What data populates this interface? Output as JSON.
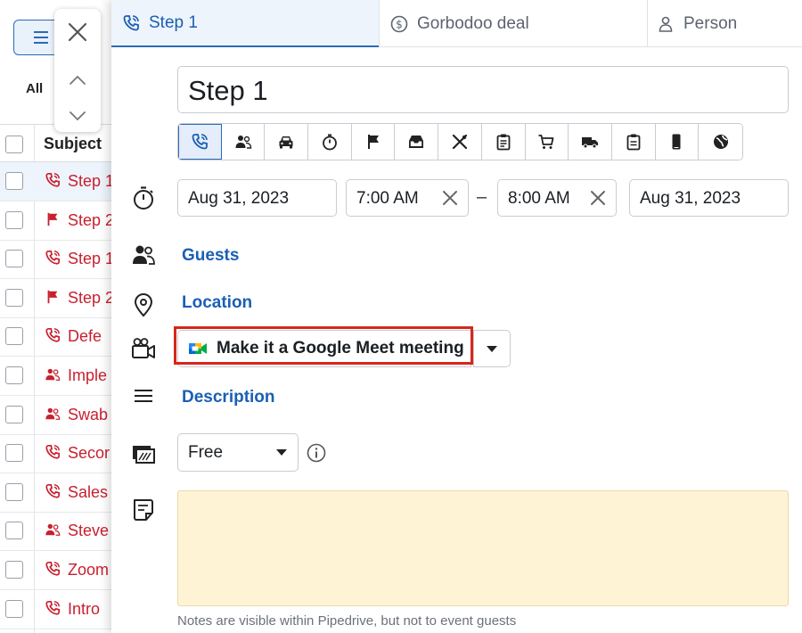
{
  "background_list": {
    "filter_label": "All",
    "subject_header": "Subject",
    "rows": [
      {
        "icon": "phone-icon",
        "text": "Step 1",
        "selected": true
      },
      {
        "icon": "flag-icon",
        "text": "Step 2"
      },
      {
        "icon": "phone-icon",
        "text": "Step 1"
      },
      {
        "icon": "flag-icon",
        "text": "Step 2"
      },
      {
        "icon": "phone-icon",
        "text": "Defe"
      },
      {
        "icon": "people-icon",
        "text": "Imple"
      },
      {
        "icon": "people-icon",
        "text": "Swab"
      },
      {
        "icon": "phone-icon",
        "text": "Secor"
      },
      {
        "icon": "phone-icon",
        "text": "Sales"
      },
      {
        "icon": "people-icon",
        "text": "Steve"
      },
      {
        "icon": "phone-icon",
        "text": "Zoom"
      },
      {
        "icon": "phone-icon",
        "text": "Intro"
      }
    ]
  },
  "tabs": [
    {
      "label": "Step 1",
      "icon": "phone-icon",
      "active": true
    },
    {
      "label": "Gorbodoo deal",
      "icon": "dollar-circle-icon"
    },
    {
      "label": "Person",
      "icon": "person-icon"
    }
  ],
  "activity": {
    "title": "Step 1",
    "types": [
      "phone",
      "meeting",
      "car",
      "deadline",
      "flag",
      "inbox",
      "lunch",
      "task",
      "cart",
      "truck",
      "clipboard",
      "mobile",
      "globe"
    ],
    "start_date": "Aug 31, 2023",
    "start_time": "7:00 AM",
    "dash": "–",
    "end_time": "8:00 AM",
    "end_date": "Aug 31, 2023",
    "guests_label": "Guests",
    "location_label": "Location",
    "meet_label": "Make it a Google Meet meeting",
    "description_label": "Description",
    "busy_value": "Free",
    "notes_hint": "Notes are visible within Pipedrive, but not to event guests"
  },
  "colors": {
    "accent": "#1a5fb4",
    "red_icon": "#c8202f",
    "highlight": "#d8261b",
    "notes_bg": "#fff3d6"
  }
}
